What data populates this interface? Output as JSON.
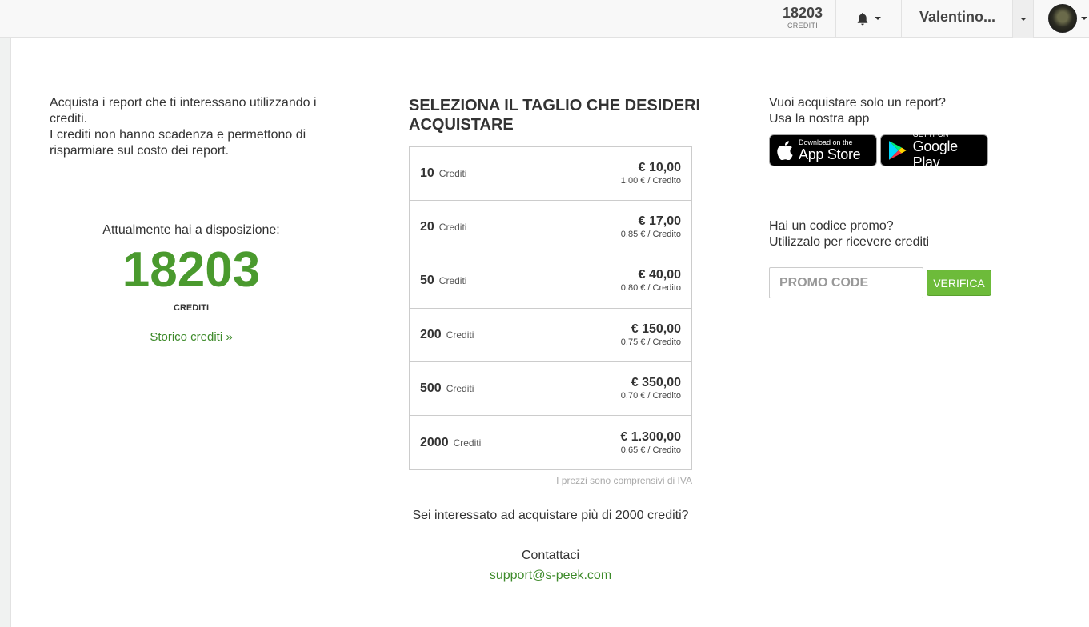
{
  "header": {
    "credits_value": "18203",
    "credits_label": "CREDITI",
    "user_name": "Valentino...",
    "icons": [
      "bell-icon",
      "chevron-down-icon",
      "avatar"
    ]
  },
  "left": {
    "intro_line1": "Acquista i report che ti interessano utilizzando i crediti.",
    "intro_line2": "I crediti non hanno scadenza e permettono di risparmiare sul costo dei report.",
    "available_label": "Attualmente hai a disposizione:",
    "available_value": "18203",
    "available_unit": "CREDITI",
    "history_link": "Storico crediti »"
  },
  "middle": {
    "title": "SELEZIONA IL TAGLIO CHE DESIDERI ACQUISTARE",
    "packages": [
      {
        "qty": "10",
        "unit": "Crediti",
        "price": "€ 10,00",
        "per": "1,00 € / Credito"
      },
      {
        "qty": "20",
        "unit": "Crediti",
        "price": "€ 17,00",
        "per": "0,85 € / Credito"
      },
      {
        "qty": "50",
        "unit": "Crediti",
        "price": "€ 40,00",
        "per": "0,80 € / Credito"
      },
      {
        "qty": "200",
        "unit": "Crediti",
        "price": "€ 150,00",
        "per": "0,75 € / Credito"
      },
      {
        "qty": "500",
        "unit": "Crediti",
        "price": "€ 350,00",
        "per": "0,70 € / Credito"
      },
      {
        "qty": "2000",
        "unit": "Crediti",
        "price": "€ 1.300,00",
        "per": "0,65 € / Credito"
      }
    ],
    "vat_note": "I prezzi sono comprensivi di IVA",
    "more_question": "Sei interessato ad acquistare più di 2000 crediti?",
    "contact_label": "Contattaci",
    "contact_email": "support@s-peek.com"
  },
  "right": {
    "app_line1": "Vuoi acquistare solo un report?",
    "app_line2": "Usa la nostra app",
    "appstore_small": "Download on the",
    "appstore_big": "App Store",
    "googleplay_small": "GET IT ON",
    "googleplay_big": "Google Play",
    "promo_line1": "Hai un codice promo?",
    "promo_line2": "Utilizzalo per ricevere crediti",
    "promo_placeholder": "PROMO CODE",
    "verify_label": "VERIFICA"
  },
  "colors": {
    "accent_green": "#4a9a2e",
    "button_green": "#6dbb3a",
    "link_green": "#3d8a2a"
  }
}
